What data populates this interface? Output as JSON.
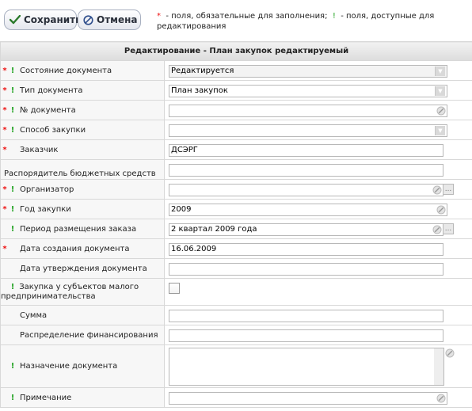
{
  "toolbar": {
    "save_label": "Сохранить",
    "cancel_label": "Отмена"
  },
  "legend": {
    "req_mark": "*",
    "req_text": "- поля, обязательные для заполнения;",
    "pub_mark": "!",
    "pub_text": "- поля, доступные для редактирования"
  },
  "form": {
    "title": "Редактирование - План закупок редактируемый",
    "fields": {
      "status": {
        "label": "Состояние документа",
        "value": "Редактируется",
        "req": "*",
        "pub": "!"
      },
      "doc_type": {
        "label": "Тип документа",
        "value": "План закупок",
        "req": "*",
        "pub": "!"
      },
      "doc_number": {
        "label": "№ документа",
        "value": "",
        "req": "*",
        "pub": "!"
      },
      "purchase_method": {
        "label": "Способ закупки",
        "value": "",
        "req": "*",
        "pub": "!"
      },
      "customer": {
        "label": "Заказчик",
        "value": "ДСЭРГ",
        "req": "*"
      },
      "budget_manager": {
        "label": "Распорядитель бюджетных средств",
        "value": ""
      },
      "organizer": {
        "label": "Организатор",
        "value": "",
        "req": "*",
        "pub": "!"
      },
      "purchase_year": {
        "label": "Год закупки",
        "value": "2009",
        "req": "*",
        "pub": "!"
      },
      "placement_period": {
        "label": "Период размещения заказа",
        "value": "2 квартал 2009 года",
        "pub": "!"
      },
      "created_date": {
        "label": "Дата создания документа",
        "value": "16.06.2009",
        "req": "*"
      },
      "approved_date": {
        "label": "Дата утверждения документа",
        "value": ""
      },
      "small_business": {
        "label": "Закупка у субъектов малого предпринимательства",
        "pub": "!"
      },
      "amount": {
        "label": "Сумма",
        "value": ""
      },
      "financing": {
        "label": "Распределение финансирования",
        "value": ""
      },
      "purpose": {
        "label": "Назначение документа",
        "value": "",
        "pub": "!"
      },
      "note": {
        "label": "Примечание",
        "value": "",
        "pub": "!"
      }
    }
  },
  "colors": {
    "required_marker": "#e11111",
    "editable_marker": "#23a323"
  }
}
